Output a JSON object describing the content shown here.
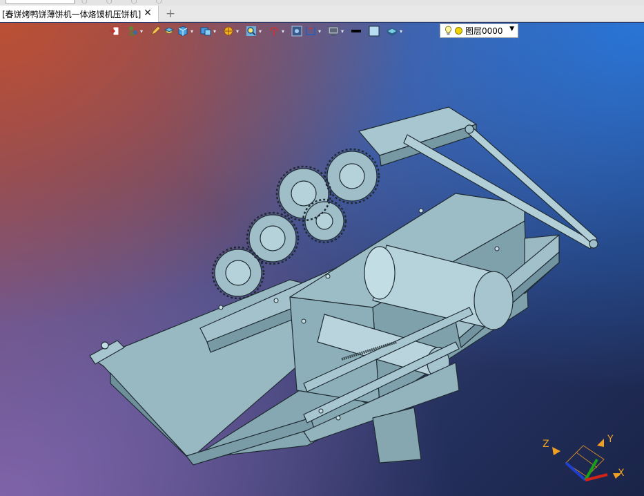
{
  "tab": {
    "title": "[春饼烤鸭饼薄饼机一体烙馍机压饼机]",
    "close_glyph": "✕",
    "add_glyph": "+"
  },
  "toolbar": {
    "layer_select": {
      "value": "图层0000"
    },
    "icons": [
      "insert-icon",
      "tree-icon",
      "pencil-icon",
      "stack-icon",
      "cube-icon",
      "render-icon",
      "sun-icon",
      "zoom-icon",
      "rotate-icon",
      "view-icon",
      "ruler-icon",
      "display-icon",
      "line-color-icon",
      "fill-color-icon",
      "layer-icon",
      "bulb-icon"
    ]
  },
  "triad": {
    "x_label": "X",
    "y_label": "Y",
    "z_label": "Z"
  },
  "colors": {
    "model_fill": "#8fb1bb",
    "model_edge": "#1f2b33",
    "axis_x": "#d0231a",
    "axis_y": "#19a019",
    "axis_z": "#1f3fcf",
    "axis_label": "#f0a020"
  }
}
